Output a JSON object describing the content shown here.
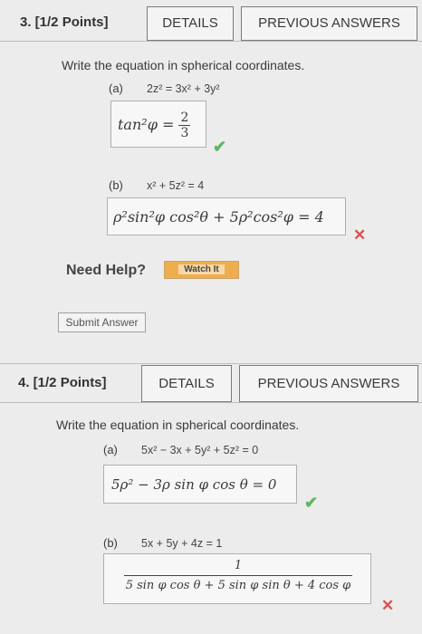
{
  "q3": {
    "header": "3.  [1/2 Points]",
    "details_label": "DETAILS",
    "prev_label": "PREVIOUS ANSWERS",
    "prompt": "Write the equation in spherical coordinates.",
    "a_label": "(a)",
    "a_eq": "2z² = 3x² + 3y²",
    "a_answer_lhs": "tan²φ =",
    "a_answer_num": "2",
    "a_answer_den": "3",
    "a_status": "✔",
    "b_label": "(b)",
    "b_eq": "x² + 5z² = 4",
    "b_answer": "ρ²sin²φ cos²θ + 5ρ²cos²φ = 4",
    "b_status": "✕",
    "need_help": "Need Help?",
    "watch_label": "Watch It",
    "submit_label": "Submit Answer"
  },
  "q4": {
    "header": "4.  [1/2 Points]",
    "details_label": "DETAILS",
    "prev_label": "PREVIOUS ANSWERS",
    "prompt": "Write the equation in spherical coordinates.",
    "a_label": "(a)",
    "a_eq": "5x² − 3x + 5y² + 5z² = 0",
    "a_answer": "5ρ² − 3ρ sin φ cos θ = 0",
    "a_status": "✔",
    "b_label": "(b)",
    "b_eq": "5x + 5y + 4z = 1",
    "b_answer_num": "1",
    "b_answer_den": "5 sin φ cos θ + 5 sin φ sin θ + 4 cos φ",
    "b_status": "✕"
  },
  "colors": {
    "correct": "#5cb85c",
    "incorrect": "#d9534f",
    "watch": "#f0ad4e"
  }
}
